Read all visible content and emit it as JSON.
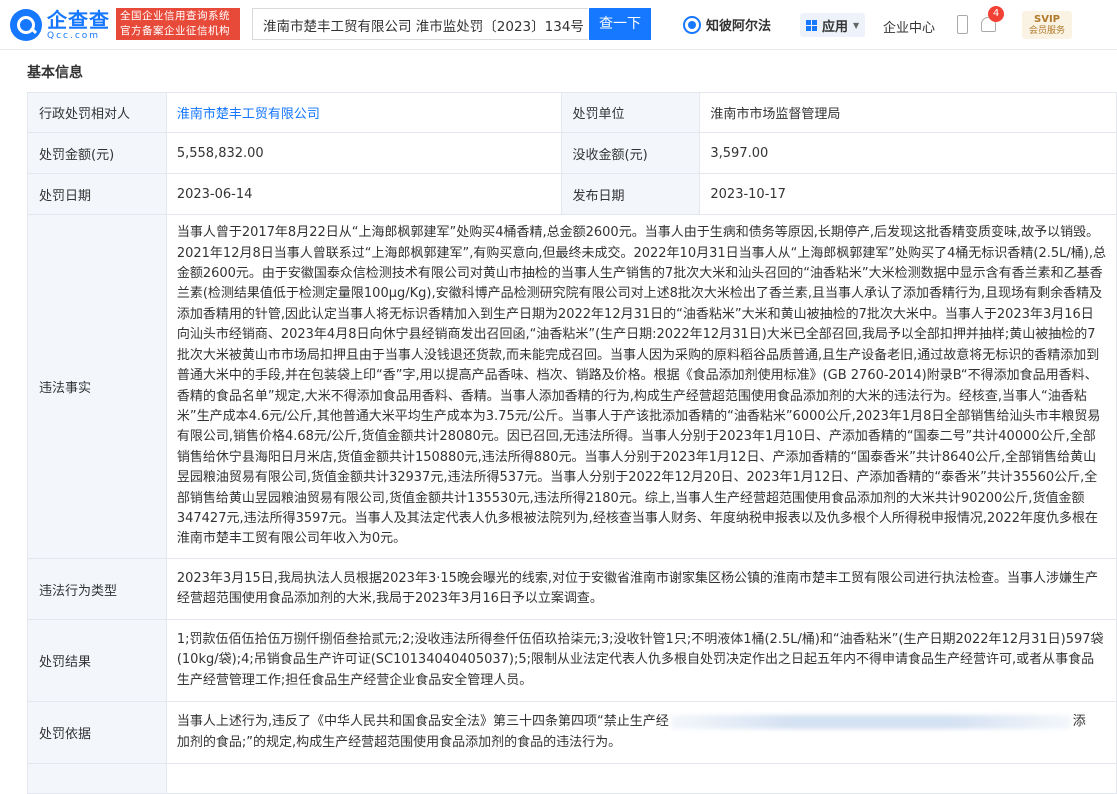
{
  "header": {
    "logo_cn": "企查查",
    "logo_en": "Qcc.com",
    "badge_line1": "全国企业信用查询系统",
    "badge_line2": "官方备案企业征信机构",
    "search_value": "淮南市楚丰工贸有限公司 淮市监处罚〔2023〕134号",
    "search_button": "查一下",
    "nav_zhi": "知彼阿尔法",
    "nav_app": "应用",
    "nav_center": "企业中心",
    "notification_count": "4",
    "svip_top": "SVIP",
    "svip_bottom": "会员服务"
  },
  "section_title": "基本信息",
  "table": {
    "target_label": "行政处罚相对人",
    "target_value": "淮南市楚丰工贸有限公司",
    "unit_label": "处罚单位",
    "unit_value": "淮南市市场监督管理局",
    "amount_label": "处罚金额(元)",
    "amount_value": "5,558,832.00",
    "confiscated_label": "没收金额(元)",
    "confiscated_value": "3,597.00",
    "date_label": "处罚日期",
    "date_value": "2023-06-14",
    "publish_label": "发布日期",
    "publish_value": "2023-10-17",
    "facts_label": "违法事实",
    "facts_value": "当事人曾于2017年8月22日从“上海郎枫郭建军”处购买4桶香精,总金额2600元。当事人由于生病和债务等原因,长期停产,后发现这批香精变质变味,故予以销毁。2021年12月8日当事人曾联系过“上海郎枫郭建军”,有购买意向,但最终未成交。2022年10月31日当事人从“上海郎枫郭建军”处购买了4桶无标识香精(2.5L/桶),总金额2600元。由于安徽国泰众信检测技术有限公司对黄山市抽检的当事人生产销售的7批次大米和汕头召回的“油香粘米”大米检测数据中显示含有香兰素和乙基香兰素(检测结果值低于检测定量限100μg/Kg),安徽科博产品检测研究院有限公司对上述8批次大米检出了香兰素,且当事人承认了添加香精行为,且现场有剩余香精及添加香精用的针管,因此认定当事人将无标识香精加入到生产日期为2022年12月31日的“油香粘米”大米和黄山被抽检的7批次大米中。当事人于2023年3月16日向汕头市经销商、2023年4月8日向休宁县经销商发出召回函,“油香粘米”(生产日期:2022年12月31日)大米已全部召回,我局予以全部扣押并抽样;黄山被抽检的7批次大米被黄山市市场局扣押且由于当事人没钱退还货款,而未能完成召回。当事人因为采购的原料稻谷品质普通,且生产设备老旧,通过故意将无标识的香精添加到普通大米中的手段,并在包装袋上印“香”字,用以提高产品香味、档次、销路及价格。根据《食品添加剂使用标准》(GB 2760-2014)附录B“不得添加食品用香料、香精的食品名单”规定,大米不得添加食品用香料、香精。当事人添加香精的行为,构成生产经营超范围使用食品添加剂的大米的违法行为。经核查,当事人“油香粘米”生产成本4.6元/公斤,其他普通大米平均生产成本为3.75元/公斤。当事人于产该批添加香精的“油香粘米”6000公斤,2023年1月8日全部销售给汕头市丰粮贸易有限公司,销售价格4.68元/公斤,货值金额共计28080元。因已召回,无违法所得。当事人分别于2023年1月10日、产添加香精的“国泰二号”共计40000公斤,全部销售给休宁县海阳日月米店,货值金额共计150880元,违法所得880元。当事人分别于2023年1月12日、产添加香精的“国泰香米”共计8640公斤,全部销售给黄山昱园粮油贸易有限公司,货值金额共计32937元,违法所得537元。当事人分别于2022年12月20日、2023年1月12日、产添加香精的“泰香米”共计35560公斤,全部销售给黄山昱园粮油贸易有限公司,货值金额共计135530元,违法所得2180元。综上,当事人生产经营超范围使用食品添加剂的大米共计90200公斤,货值金额347427元,违法所得3597元。当事人及其法定代表人仇多根被法院列为,经核查当事人财务、年度纳税申报表以及仇多根个人所得税申报情况,2022年度仇多根在淮南市楚丰工贸有限公司年收入为0元。",
    "type_label": "违法行为类型",
    "type_value": "2023年3月15日,我局执法人员根据2023年3·15晚会曝光的线索,对位于安徽省淮南市谢家集区杨公镇的淮南市楚丰工贸有限公司进行执法检查。当事人涉嫌生产经营超范围使用食品添加剂的大米,我局于2023年3月16日予以立案调查。",
    "result_label": "处罚结果",
    "result_value": "1;罚款伍佰伍拾伍万捌仟捌佰叁拾贰元;2;没收违法所得叁仟伍佰玖拾柒元;3;没收针管1只;不明液体1桶(2.5L/桶)和“油香粘米”(生产日期2022年12月31日)597袋(10kg/袋);4;吊销食品生产许可证(SC10134040405037);5;限制从业法定代表人仇多根自处罚决定作出之日起五年内不得申请食品生产经营许可,或者从事食品生产经营管理工作;担任食品生产经营企业食品安全管理人员。",
    "basis_label": "处罚依据",
    "basis_value_start": "当事人上述行为,违反了《中华人民共和国食品安全法》第三十四条第四项“禁止生产经",
    "basis_value_end": "添",
    "basis_value_line2": "加剂的食品;”的规定,构成生产经营超范围使用食品添加剂的食品的违法行为。"
  }
}
